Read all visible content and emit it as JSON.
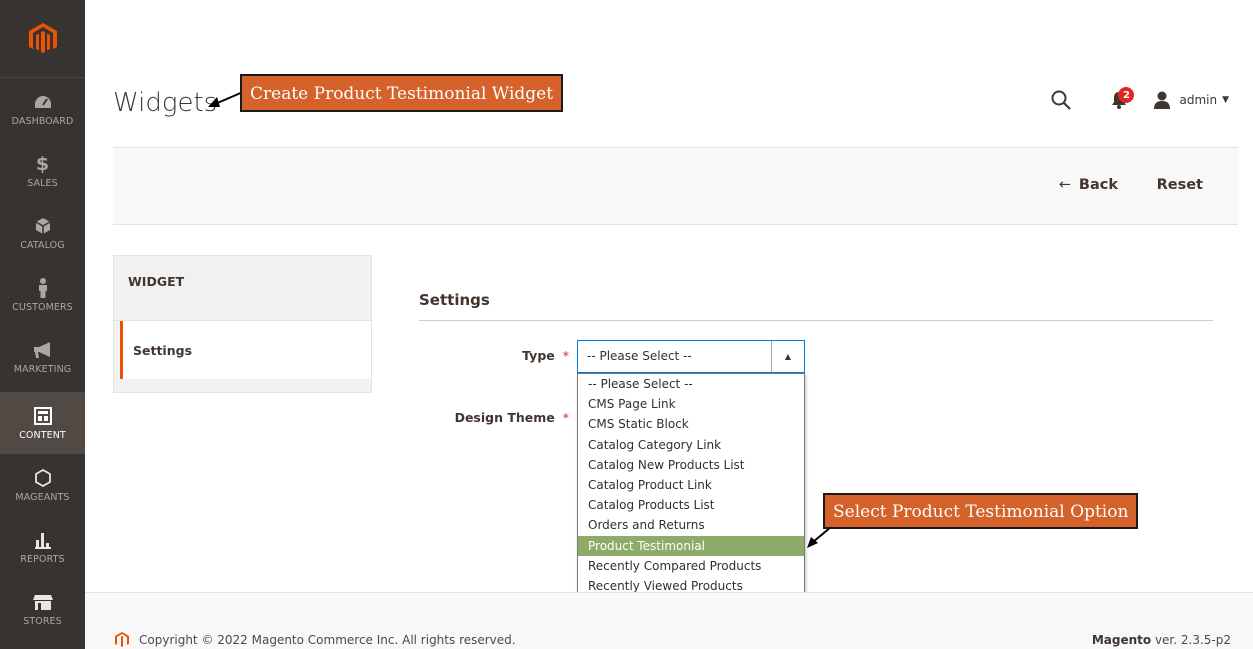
{
  "colors": {
    "sidebar": "#373330",
    "accent": "#eb5202",
    "callout": "#d4622a",
    "highlight": "#8eab6a"
  },
  "sidebar": {
    "items": [
      {
        "label": "DASHBOARD",
        "icon": "dashboard-icon"
      },
      {
        "label": "SALES",
        "icon": "dollar-icon"
      },
      {
        "label": "CATALOG",
        "icon": "cube-icon"
      },
      {
        "label": "CUSTOMERS",
        "icon": "person-icon"
      },
      {
        "label": "MARKETING",
        "icon": "megaphone-icon"
      },
      {
        "label": "CONTENT",
        "icon": "layout-icon",
        "active": true
      },
      {
        "label": "MAGEANTS",
        "icon": "hexagon-icon"
      },
      {
        "label": "REPORTS",
        "icon": "bar-chart-icon"
      },
      {
        "label": "STORES",
        "icon": "store-icon"
      }
    ]
  },
  "header": {
    "title": "Widgets",
    "notification_count": "2",
    "user": "admin"
  },
  "annotations": {
    "title_callout": "Create Product Testimonial Widget",
    "option_callout": "Select Product Testimonial Option"
  },
  "actions": {
    "back": "Back",
    "reset": "Reset"
  },
  "tabs": {
    "title": "WIDGET",
    "items": [
      "Settings"
    ]
  },
  "form": {
    "section_title": "Settings",
    "type_label": "Type",
    "design_theme_label": "Design Theme",
    "type_value": "-- Please Select --",
    "options": [
      "-- Please Select --",
      "CMS Page Link",
      "CMS Static Block",
      "Catalog Category Link",
      "Catalog New Products List",
      "Catalog Product Link",
      "Catalog Products List",
      "Orders and Returns",
      "Product Testimonial",
      "Recently Compared Products",
      "Recently Viewed Products"
    ],
    "highlighted_option": "Product Testimonial"
  },
  "footer": {
    "copyright": "Copyright © 2022 Magento Commerce Inc. All rights reserved.",
    "brand": "Magento",
    "version": " ver. 2.3.5-p2"
  }
}
